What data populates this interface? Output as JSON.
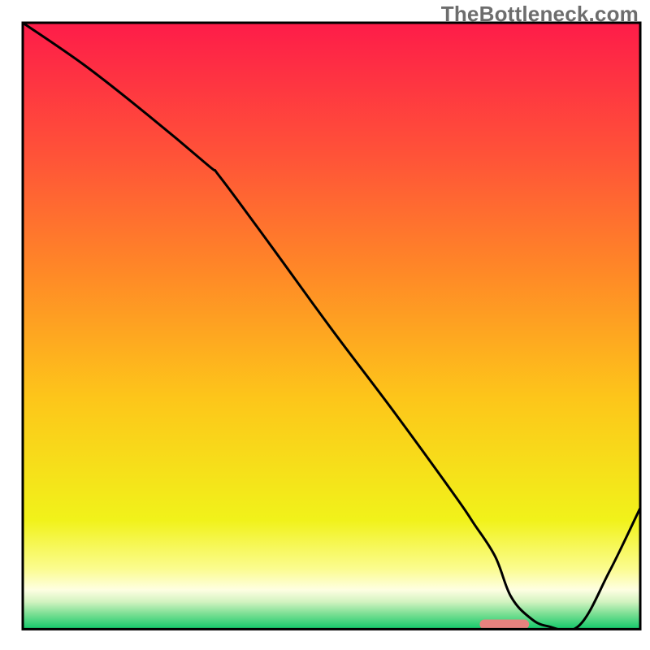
{
  "watermark": "TheBottleneck.com",
  "chart_data": {
    "type": "line",
    "title": "",
    "xlabel": "",
    "ylabel": "",
    "xlim": [
      0,
      100
    ],
    "ylim": [
      0,
      100
    ],
    "axes_visible": false,
    "grid": false,
    "legend": false,
    "background_gradient": {
      "type": "vertical",
      "stops": [
        {
          "offset": 0.0,
          "color": "#fe1c49"
        },
        {
          "offset": 0.22,
          "color": "#ff5338"
        },
        {
          "offset": 0.42,
          "color": "#ff8b26"
        },
        {
          "offset": 0.62,
          "color": "#fdc61a"
        },
        {
          "offset": 0.82,
          "color": "#f1f21a"
        },
        {
          "offset": 0.9,
          "color": "#fbfc8e"
        },
        {
          "offset": 0.935,
          "color": "#fefee2"
        },
        {
          "offset": 0.955,
          "color": "#d2f3c0"
        },
        {
          "offset": 0.975,
          "color": "#7adf93"
        },
        {
          "offset": 1.0,
          "color": "#11c869"
        }
      ]
    },
    "series": [
      {
        "name": "bottleneck-curve",
        "color": "#000000",
        "stroke_width": 3,
        "x": [
          0.0,
          10.0,
          20.0,
          30.0,
          32.0,
          40.0,
          50.0,
          60.0,
          70.0,
          73.0,
          76.5,
          79.0,
          82.0,
          85.0,
          90.0,
          95.0,
          100.0
        ],
        "y": [
          100.0,
          93.0,
          85.0,
          76.5,
          74.5,
          63.5,
          49.5,
          36.0,
          22.0,
          17.5,
          12.0,
          5.5,
          2.0,
          0.5,
          0.5,
          9.5,
          20.0
        ]
      }
    ],
    "markers": [
      {
        "name": "highlight-segment",
        "shape": "rounded-bar",
        "color": "#e7827f",
        "x_start": 74.0,
        "x_end": 82.0,
        "y": 0.8,
        "thickness_pct": 1.6
      }
    ],
    "frame": {
      "stroke": "#000000",
      "stroke_width": 3,
      "inset_left_pct": 3.5,
      "inset_right_pct": 1.5,
      "inset_top_pct": 3.5,
      "inset_bottom_pct": 3.2
    }
  }
}
